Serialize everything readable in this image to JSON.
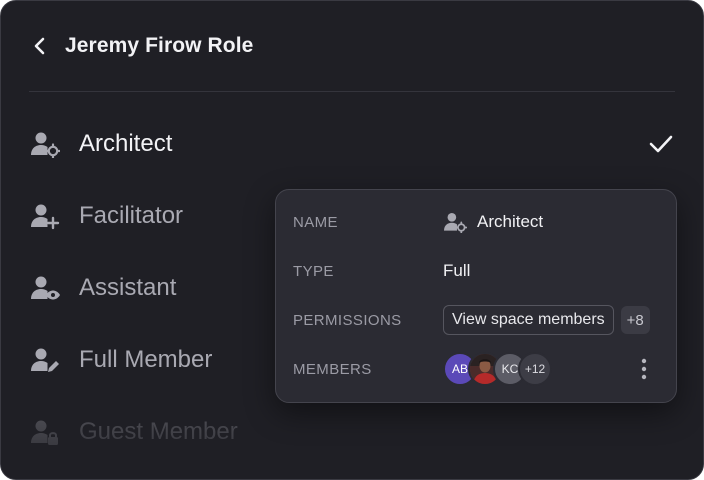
{
  "header": {
    "title": "Jeremy Firow Role",
    "back_icon": "chevron-left-icon"
  },
  "roles": [
    {
      "label": "Architect",
      "icon": "user-gear-icon",
      "selected": true
    },
    {
      "label": "Facilitator",
      "icon": "user-plus-icon",
      "selected": false
    },
    {
      "label": "Assistant",
      "icon": "user-eye-icon",
      "selected": false
    },
    {
      "label": "Full Member",
      "icon": "user-pen-icon",
      "selected": false
    },
    {
      "label": "Guest Member",
      "icon": "user-lock-icon",
      "selected": false
    }
  ],
  "details": {
    "name_key": "NAME",
    "name_value": "Architect",
    "type_key": "TYPE",
    "type_value": "Full",
    "permissions_key": "PERMISSIONS",
    "permission_chip": "View space members",
    "permission_more": "+8",
    "members_key": "MEMBERS",
    "members": [
      {
        "initials": "AB",
        "color": "#5b49b8"
      },
      {
        "initials": "",
        "color": "#6b3a36"
      },
      {
        "initials": "KC",
        "color": "#5c5c66"
      }
    ],
    "members_more": "+12"
  },
  "colors": {
    "panel_bg": "#1f1f25",
    "card_bg": "#2b2b33",
    "text_primary": "#f2f2f5",
    "text_muted": "#a9a9b2"
  }
}
